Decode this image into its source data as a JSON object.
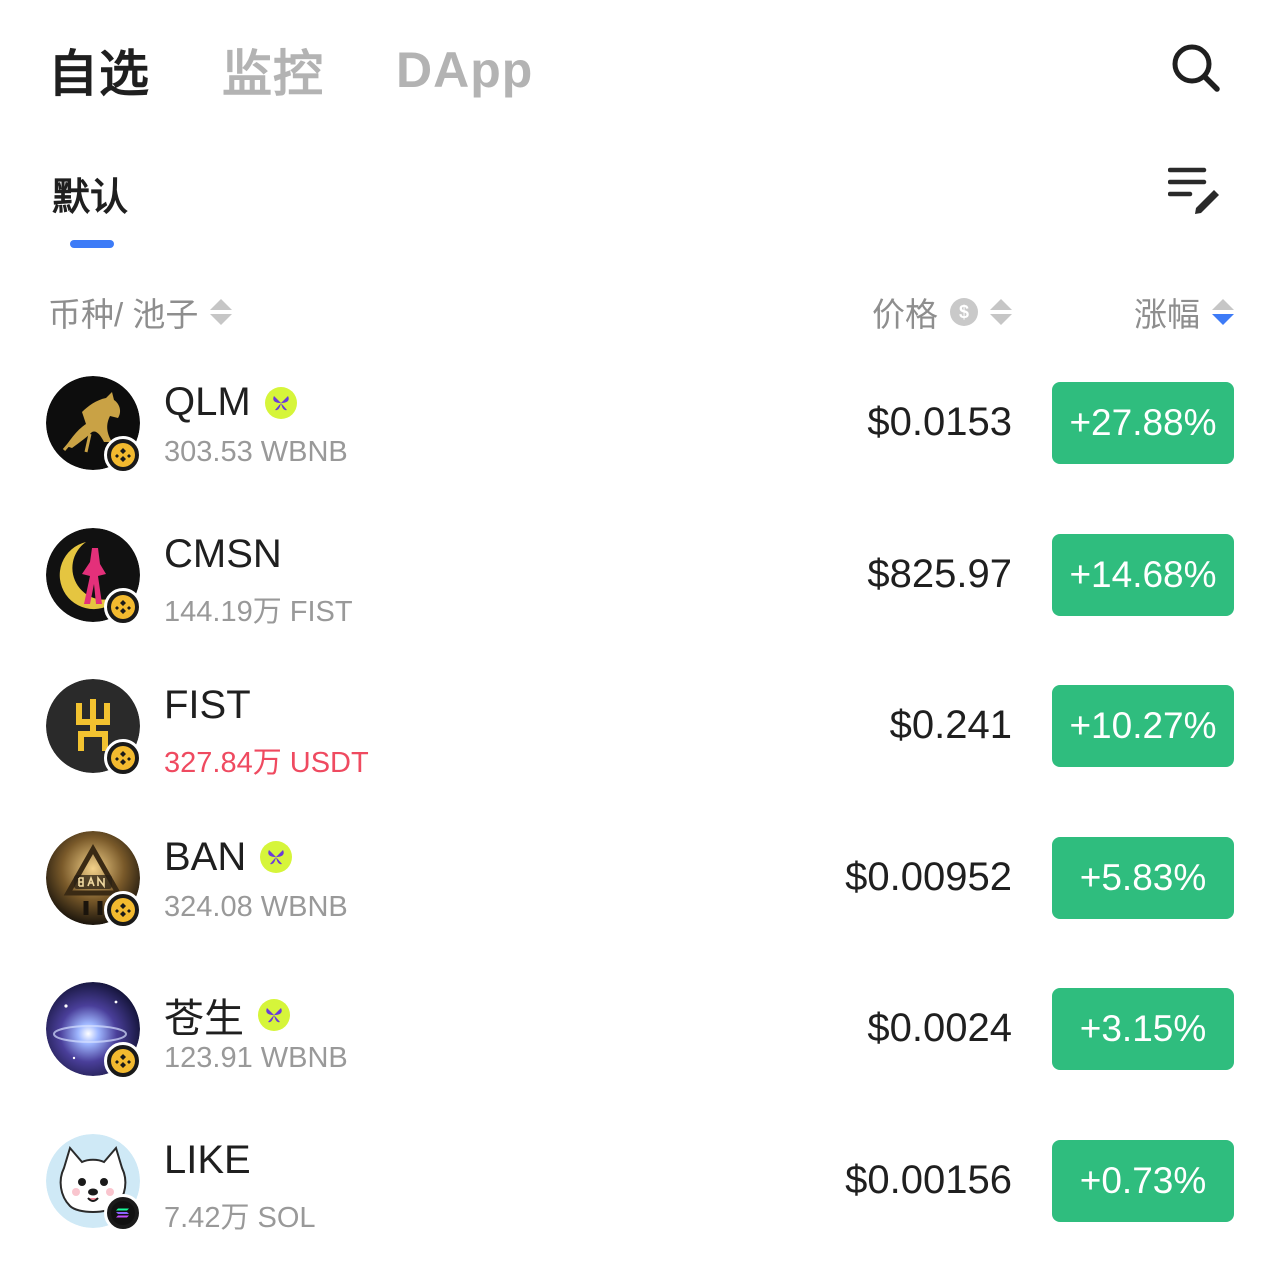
{
  "top_tabs": [
    {
      "label": "自选",
      "active": true
    },
    {
      "label": "监控",
      "active": false
    },
    {
      "label": "DApp",
      "active": false
    }
  ],
  "icons": {
    "search": "search-icon",
    "edit_list": "edit-list-icon",
    "price_currency": "dollar-circle-icon",
    "verified": "verified-butterfly-icon",
    "bnb_chain": "bnb-chain-icon",
    "solana_chain": "solana-chain-icon"
  },
  "sub_tab": {
    "label": "默认"
  },
  "columns": {
    "coin": "币种/ 池子",
    "price": "价格",
    "price_currency_symbol": "$",
    "change": "涨幅"
  },
  "colors": {
    "accent": "#3d7bf7",
    "up_green": "#2fbd7e",
    "hot_red": "#ef4a60",
    "verify_lime": "#d6f53a"
  },
  "tokens": [
    {
      "name": "QLM",
      "verified": true,
      "pool": "303.53 WBNB",
      "pool_hot": false,
      "price": "$0.0153",
      "change": "+27.88%",
      "chain": "bnb"
    },
    {
      "name": "CMSN",
      "verified": false,
      "pool": "144.19万 FIST",
      "pool_hot": false,
      "price": "$825.97",
      "change": "+14.68%",
      "chain": "bnb"
    },
    {
      "name": "FIST",
      "verified": false,
      "pool": "327.84万 USDT",
      "pool_hot": true,
      "price": "$0.241",
      "change": "+10.27%",
      "chain": "bnb"
    },
    {
      "name": "BAN",
      "verified": true,
      "pool": "324.08 WBNB",
      "pool_hot": false,
      "price": "$0.00952",
      "change": "+5.83%",
      "chain": "bnb"
    },
    {
      "name": "苍生",
      "verified": true,
      "pool": "123.91 WBNB",
      "pool_hot": false,
      "price": "$0.0024",
      "change": "+3.15%",
      "chain": "bnb"
    },
    {
      "name": "LIKE",
      "verified": false,
      "pool": "7.42万 SOL",
      "pool_hot": false,
      "price": "$0.00156",
      "change": "+0.73%",
      "chain": "sol"
    }
  ]
}
